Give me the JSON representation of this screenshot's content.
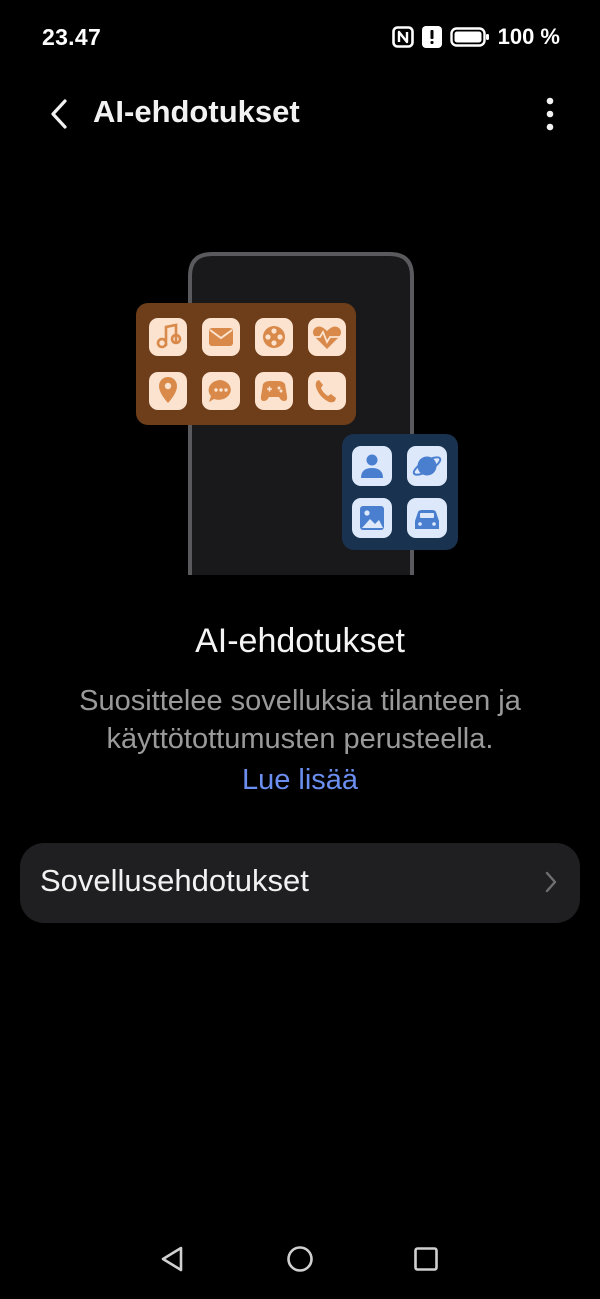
{
  "status_bar": {
    "time": "23.47",
    "battery_percent": "100 %",
    "icons": [
      "nfc-icon",
      "alert-icon",
      "battery-icon"
    ]
  },
  "app_bar": {
    "title": "AI-ehdotukset",
    "back_icon": "chevron-left-icon",
    "more_icon": "more-vertical-icon"
  },
  "hero": {
    "title": "AI-ehdotukset",
    "description": "Suosittelee sovelluksia tilanteen ja käyttötottumusten perusteella.",
    "link": "Lue lisää"
  },
  "settings": {
    "items": [
      {
        "label": "Sovellusehdotukset",
        "icon": "chevron-right-icon"
      }
    ]
  },
  "colors": {
    "background": "#000000",
    "card": "#1f1f21",
    "link": "#6b8ff0",
    "secondary_text": "#9a9a9a",
    "orange_panel": "#6e3e1a",
    "orange_tile": "#fbe3d0",
    "orange_glyph": "#d98a4a",
    "blue_panel": "#183250",
    "blue_tile": "#dde9fb",
    "blue_glyph": "#4a7fd0"
  },
  "illustration": {
    "orange_apps": [
      "music-icon",
      "mail-icon",
      "film-reel-icon",
      "heart-rate-icon",
      "location-pin-icon",
      "chat-icon",
      "gamepad-icon",
      "phone-icon"
    ],
    "blue_apps": [
      "person-icon",
      "planet-icon",
      "image-icon",
      "car-icon"
    ]
  },
  "nav_bar": {
    "icons": [
      "nav-back-icon",
      "nav-home-icon",
      "nav-recents-icon"
    ]
  }
}
